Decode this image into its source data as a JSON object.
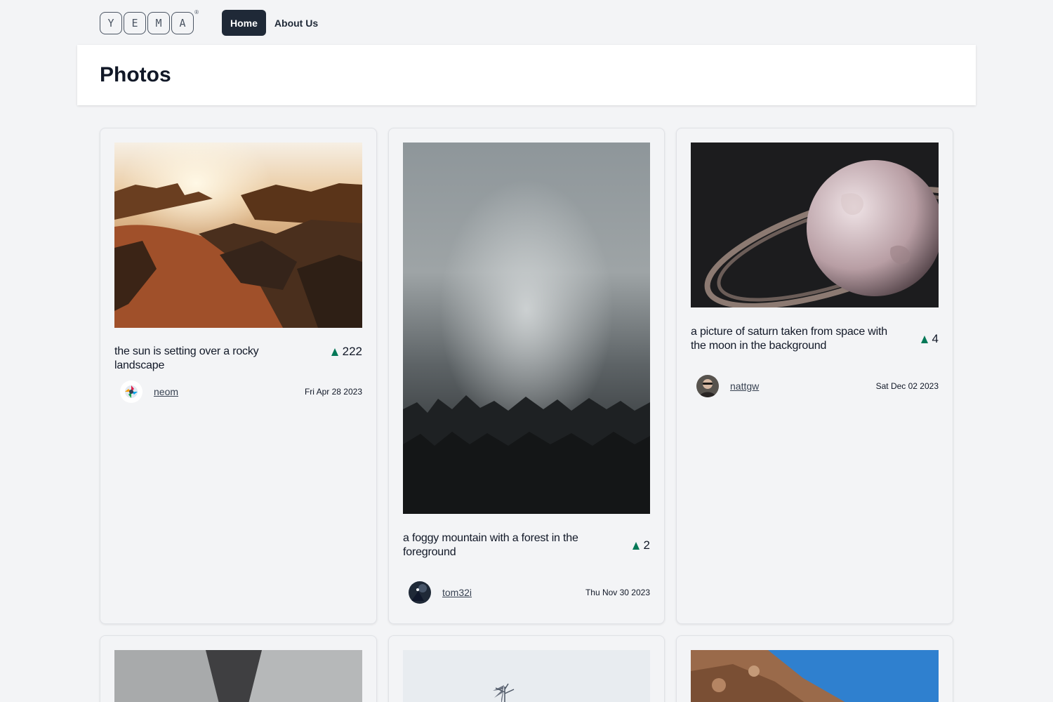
{
  "nav": {
    "logo_letters": [
      "Y",
      "E",
      "M",
      "A"
    ],
    "logo_mark": "®",
    "home_label": "Home",
    "about_label": "About Us"
  },
  "page": {
    "title": "Photos"
  },
  "accent": {
    "vote": "#047857",
    "nav_active": "#1f2937"
  },
  "photos": [
    {
      "caption": "the sun is setting over a rocky landscape",
      "votes": "222",
      "user": "neom",
      "date": "Fri Apr 28 2023"
    },
    {
      "caption": "a foggy mountain with a forest in the foreground",
      "votes": "2",
      "user": "tom32i",
      "date": "Thu Nov 30 2023"
    },
    {
      "caption": "a picture of saturn taken from space with the moon in the background",
      "votes": "4",
      "user": "nattgw",
      "date": "Sat Dec 02 2023"
    }
  ]
}
